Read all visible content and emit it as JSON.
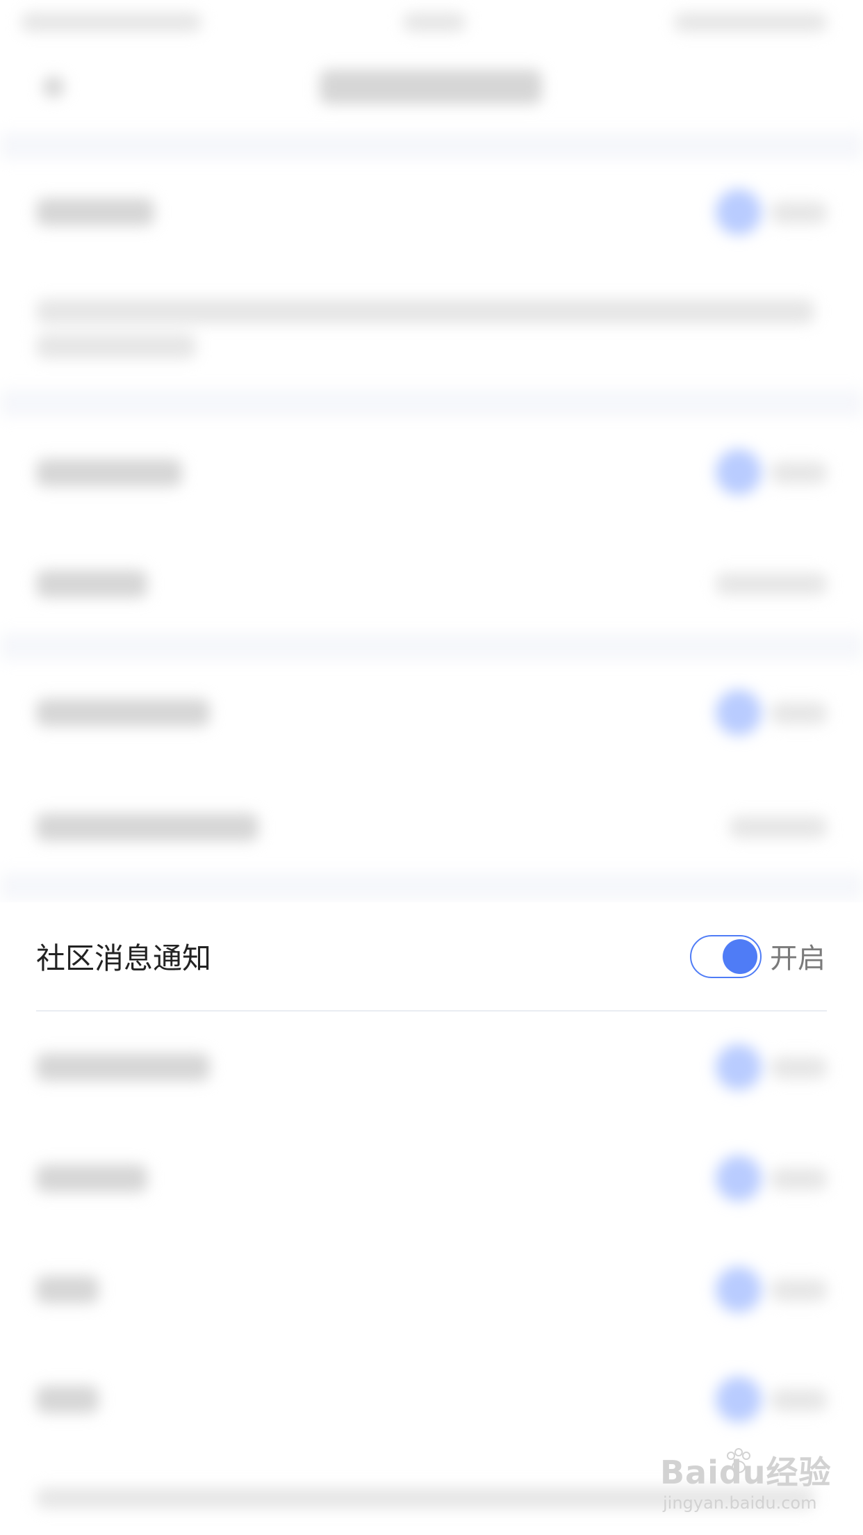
{
  "setting": {
    "label": "社区消息通知",
    "state_text": "开启",
    "enabled": true,
    "accent_color": "#4f7cf6"
  },
  "watermark": {
    "logo": "Baidu经验",
    "url": "jingyan.baidu.com"
  }
}
